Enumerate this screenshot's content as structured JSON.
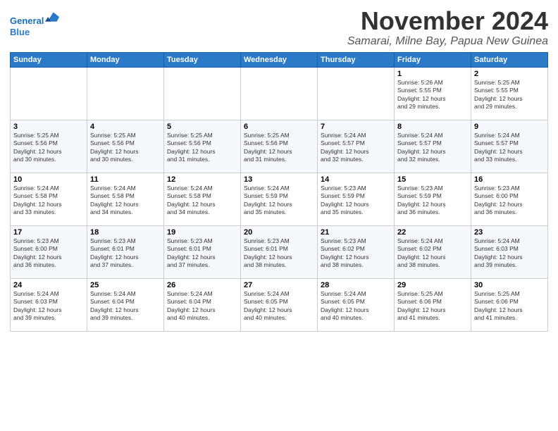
{
  "header": {
    "logo_line1": "General",
    "logo_line2": "Blue",
    "month": "November 2024",
    "location": "Samarai, Milne Bay, Papua New Guinea"
  },
  "weekdays": [
    "Sunday",
    "Monday",
    "Tuesday",
    "Wednesday",
    "Thursday",
    "Friday",
    "Saturday"
  ],
  "weeks": [
    [
      {
        "day": "",
        "info": ""
      },
      {
        "day": "",
        "info": ""
      },
      {
        "day": "",
        "info": ""
      },
      {
        "day": "",
        "info": ""
      },
      {
        "day": "",
        "info": ""
      },
      {
        "day": "1",
        "info": "Sunrise: 5:26 AM\nSunset: 5:55 PM\nDaylight: 12 hours\nand 29 minutes."
      },
      {
        "day": "2",
        "info": "Sunrise: 5:25 AM\nSunset: 5:55 PM\nDaylight: 12 hours\nand 29 minutes."
      }
    ],
    [
      {
        "day": "3",
        "info": "Sunrise: 5:25 AM\nSunset: 5:56 PM\nDaylight: 12 hours\nand 30 minutes."
      },
      {
        "day": "4",
        "info": "Sunrise: 5:25 AM\nSunset: 5:56 PM\nDaylight: 12 hours\nand 30 minutes."
      },
      {
        "day": "5",
        "info": "Sunrise: 5:25 AM\nSunset: 5:56 PM\nDaylight: 12 hours\nand 31 minutes."
      },
      {
        "day": "6",
        "info": "Sunrise: 5:25 AM\nSunset: 5:56 PM\nDaylight: 12 hours\nand 31 minutes."
      },
      {
        "day": "7",
        "info": "Sunrise: 5:24 AM\nSunset: 5:57 PM\nDaylight: 12 hours\nand 32 minutes."
      },
      {
        "day": "8",
        "info": "Sunrise: 5:24 AM\nSunset: 5:57 PM\nDaylight: 12 hours\nand 32 minutes."
      },
      {
        "day": "9",
        "info": "Sunrise: 5:24 AM\nSunset: 5:57 PM\nDaylight: 12 hours\nand 33 minutes."
      }
    ],
    [
      {
        "day": "10",
        "info": "Sunrise: 5:24 AM\nSunset: 5:58 PM\nDaylight: 12 hours\nand 33 minutes."
      },
      {
        "day": "11",
        "info": "Sunrise: 5:24 AM\nSunset: 5:58 PM\nDaylight: 12 hours\nand 34 minutes."
      },
      {
        "day": "12",
        "info": "Sunrise: 5:24 AM\nSunset: 5:58 PM\nDaylight: 12 hours\nand 34 minutes."
      },
      {
        "day": "13",
        "info": "Sunrise: 5:24 AM\nSunset: 5:59 PM\nDaylight: 12 hours\nand 35 minutes."
      },
      {
        "day": "14",
        "info": "Sunrise: 5:23 AM\nSunset: 5:59 PM\nDaylight: 12 hours\nand 35 minutes."
      },
      {
        "day": "15",
        "info": "Sunrise: 5:23 AM\nSunset: 5:59 PM\nDaylight: 12 hours\nand 36 minutes."
      },
      {
        "day": "16",
        "info": "Sunrise: 5:23 AM\nSunset: 6:00 PM\nDaylight: 12 hours\nand 36 minutes."
      }
    ],
    [
      {
        "day": "17",
        "info": "Sunrise: 5:23 AM\nSunset: 6:00 PM\nDaylight: 12 hours\nand 36 minutes."
      },
      {
        "day": "18",
        "info": "Sunrise: 5:23 AM\nSunset: 6:01 PM\nDaylight: 12 hours\nand 37 minutes."
      },
      {
        "day": "19",
        "info": "Sunrise: 5:23 AM\nSunset: 6:01 PM\nDaylight: 12 hours\nand 37 minutes."
      },
      {
        "day": "20",
        "info": "Sunrise: 5:23 AM\nSunset: 6:01 PM\nDaylight: 12 hours\nand 38 minutes."
      },
      {
        "day": "21",
        "info": "Sunrise: 5:23 AM\nSunset: 6:02 PM\nDaylight: 12 hours\nand 38 minutes."
      },
      {
        "day": "22",
        "info": "Sunrise: 5:24 AM\nSunset: 6:02 PM\nDaylight: 12 hours\nand 38 minutes."
      },
      {
        "day": "23",
        "info": "Sunrise: 5:24 AM\nSunset: 6:03 PM\nDaylight: 12 hours\nand 39 minutes."
      }
    ],
    [
      {
        "day": "24",
        "info": "Sunrise: 5:24 AM\nSunset: 6:03 PM\nDaylight: 12 hours\nand 39 minutes."
      },
      {
        "day": "25",
        "info": "Sunrise: 5:24 AM\nSunset: 6:04 PM\nDaylight: 12 hours\nand 39 minutes."
      },
      {
        "day": "26",
        "info": "Sunrise: 5:24 AM\nSunset: 6:04 PM\nDaylight: 12 hours\nand 40 minutes."
      },
      {
        "day": "27",
        "info": "Sunrise: 5:24 AM\nSunset: 6:05 PM\nDaylight: 12 hours\nand 40 minutes."
      },
      {
        "day": "28",
        "info": "Sunrise: 5:24 AM\nSunset: 6:05 PM\nDaylight: 12 hours\nand 40 minutes."
      },
      {
        "day": "29",
        "info": "Sunrise: 5:25 AM\nSunset: 6:06 PM\nDaylight: 12 hours\nand 41 minutes."
      },
      {
        "day": "30",
        "info": "Sunrise: 5:25 AM\nSunset: 6:06 PM\nDaylight: 12 hours\nand 41 minutes."
      }
    ]
  ]
}
